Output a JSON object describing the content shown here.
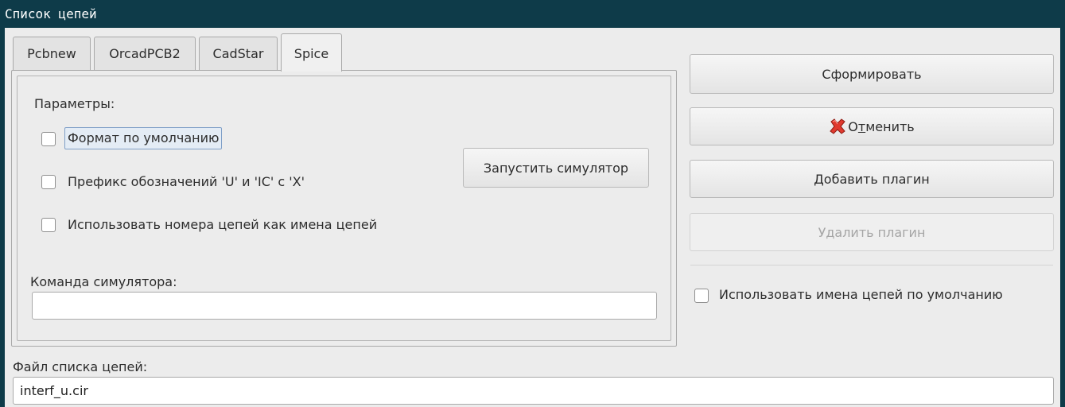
{
  "window": {
    "title": "Список цепей"
  },
  "tabs": [
    {
      "label": "Pcbnew"
    },
    {
      "label": "OrcadPCB2"
    },
    {
      "label": "CadStar"
    },
    {
      "label": "Spice"
    }
  ],
  "panel": {
    "params_label": "Параметры:",
    "options": [
      {
        "label": "Формат по умолчанию",
        "checked": false
      },
      {
        "label": "Префикс обозначений 'U' и 'IC' с 'X'",
        "checked": false
      },
      {
        "label": "Использовать номера цепей  как имена цепей",
        "checked": false
      }
    ],
    "run_simulator": "Запустить симулятор",
    "sim_command_label": "Команда симулятора:",
    "sim_command_value": ""
  },
  "actions": {
    "generate": "Сформировать",
    "cancel_prefix": "О",
    "cancel_accel": "т",
    "cancel_rest": "менить",
    "add_plugin": "Добавить плагин",
    "remove_plugin": "Удалить плагин",
    "use_default_names": "Использовать имена цепей по умолчанию",
    "use_default_names_checked": false
  },
  "file": {
    "label": "Файл списка цепей:",
    "value": "interf_u.cir"
  },
  "icons": {
    "cancel": "red-x-cancel-icon"
  },
  "colors": {
    "titlebar": "#0e3b49",
    "focus": "#7f9fc7"
  }
}
